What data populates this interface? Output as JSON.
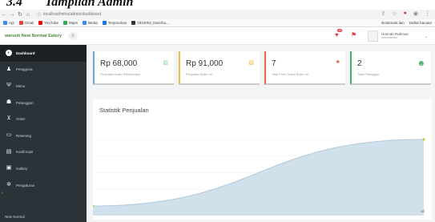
{
  "caption": {
    "number": "3.4",
    "title": "Tampilan Admin"
  },
  "browser": {
    "url": "localhost/mitra/admin/dashboard",
    "bookmarks": [
      {
        "label": "Apl",
        "color": "#4285f4"
      },
      {
        "label": "Gmail",
        "color": "#ea4335"
      },
      {
        "label": "YouTube",
        "color": "#ff0000"
      },
      {
        "label": "Maps",
        "color": "#34a853"
      },
      {
        "label": "Berita",
        "color": "#4285f4"
      },
      {
        "label": "Terjemahan",
        "color": "#1a73e8"
      },
      {
        "label": "1834004_Darinha…",
        "color": "#333333"
      }
    ],
    "bookmark_right": [
      "Bookmark lain",
      "Daftar bacaan"
    ]
  },
  "header": {
    "brand": "warunk New Normal Eatery",
    "notif_count": "10",
    "user_name": "Hannah Rahman",
    "user_role": "Administrator"
  },
  "sidebar": {
    "items": [
      {
        "label": "Dashboard",
        "icon": "dashboard-icon"
      },
      {
        "label": "Pengguna",
        "icon": "user-icon"
      },
      {
        "label": "Menu",
        "icon": "fork-knife-icon"
      },
      {
        "label": "Pelanggan",
        "icon": "users-icon"
      },
      {
        "label": "Order",
        "icon": "cart-icon"
      },
      {
        "label": "Rekening",
        "icon": "card-icon"
      },
      {
        "label": "Konfirmasi",
        "icon": "money-icon"
      },
      {
        "label": "Gallery",
        "icon": "image-icon"
      },
      {
        "label": "Pengaturan",
        "icon": "gear-icon"
      }
    ],
    "footer": "New Normal"
  },
  "cards": [
    {
      "value": "Rp 68,000",
      "label": "Penjualan Bulan Sebelumnya",
      "accent": "#6aa7d8"
    },
    {
      "value": "Rp 91,000",
      "label": "Penjualan Bulan Ini",
      "accent": "#f4b740"
    },
    {
      "value": "7",
      "label": "Total Porsi Terjual Bulan Ini",
      "accent": "#e56a4a"
    },
    {
      "value": "2",
      "label": "Total Pelanggan",
      "accent": "#46b36a"
    }
  ],
  "chart": {
    "title": "Statistik Penjualan",
    "colors": {
      "fill": "#c9dce9",
      "line": "#b3cadd",
      "point": "#b8d43a"
    }
  },
  "chart_data": {
    "type": "area",
    "x": [
      0,
      1
    ],
    "values": [
      0,
      91000
    ],
    "title": "Statistik Penjualan",
    "x_tick_labels": [
      "",
      "10"
    ]
  }
}
